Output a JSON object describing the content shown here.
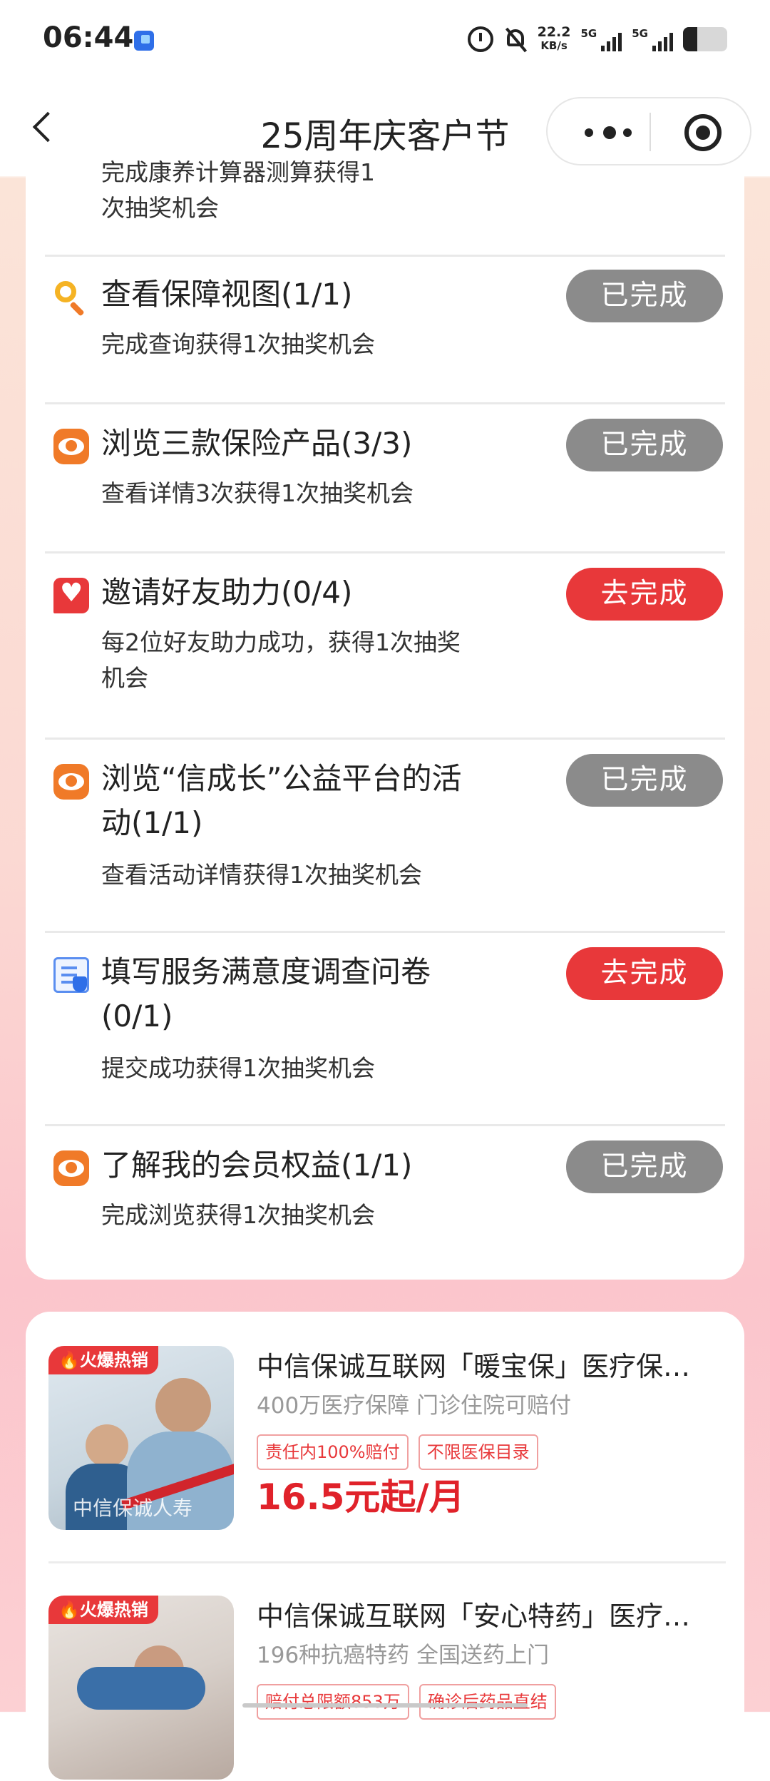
{
  "status_bar": {
    "time": "06:44",
    "speed_value": "22.2",
    "speed_unit": "KB/s",
    "network1": "5G",
    "network2": "5G"
  },
  "nav": {
    "title": "25周年庆客户节"
  },
  "tasks": [
    {
      "name": "",
      "desc": "完成康养计算器测算获得1次抽奖机会",
      "icon": "none",
      "button": ""
    },
    {
      "name": "查看保障视图(1/1)",
      "desc": "完成查询获得1次抽奖机会",
      "icon": "search-icon",
      "button": "已完成"
    },
    {
      "name": "浏览三款保险产品(3/3)",
      "desc": "查看详情3次获得1次抽奖机会",
      "icon": "eye-icon",
      "button": "已完成"
    },
    {
      "name": "邀请好友助力(0/4)",
      "desc": "每2位好友助力成功，获得1次抽奖机会",
      "icon": "heart-icon",
      "button": "去完成"
    },
    {
      "name": "浏览“信成长”公益平台的活动(1/1)",
      "desc": "查看活动详情获得1次抽奖机会",
      "icon": "eye-icon",
      "button": "已完成"
    },
    {
      "name": "填写服务满意度调查问卷(0/1)",
      "desc": "提交成功获得1次抽奖机会",
      "icon": "form-icon",
      "button": "去完成"
    },
    {
      "name": "了解我的会员权益(1/1)",
      "desc": "完成浏览获得1次抽奖机会",
      "icon": "eye-icon",
      "button": "已完成"
    }
  ],
  "products": [
    {
      "tag": "🔥火爆热销",
      "watermark": "中信保诚人寿",
      "title": "中信保诚互联网「暖宝保」医疗保…",
      "subtitle": "400万医疗保障 门诊住院可赔付",
      "badges": [
        "责任内100%赔付",
        "不限医保目录"
      ],
      "price": "16.5元起/月"
    },
    {
      "tag": "🔥火爆热销",
      "title": "中信保诚互联网「安心特药」医疗…",
      "subtitle": "196种抗癌特药 全国送药上门",
      "badges": [
        "赔付总限额853万",
        "确诊后药品直结"
      ]
    }
  ],
  "colors": {
    "accent_red": "#e8383a",
    "done_gray": "#8b8b8b",
    "price_red": "#e0222a"
  }
}
